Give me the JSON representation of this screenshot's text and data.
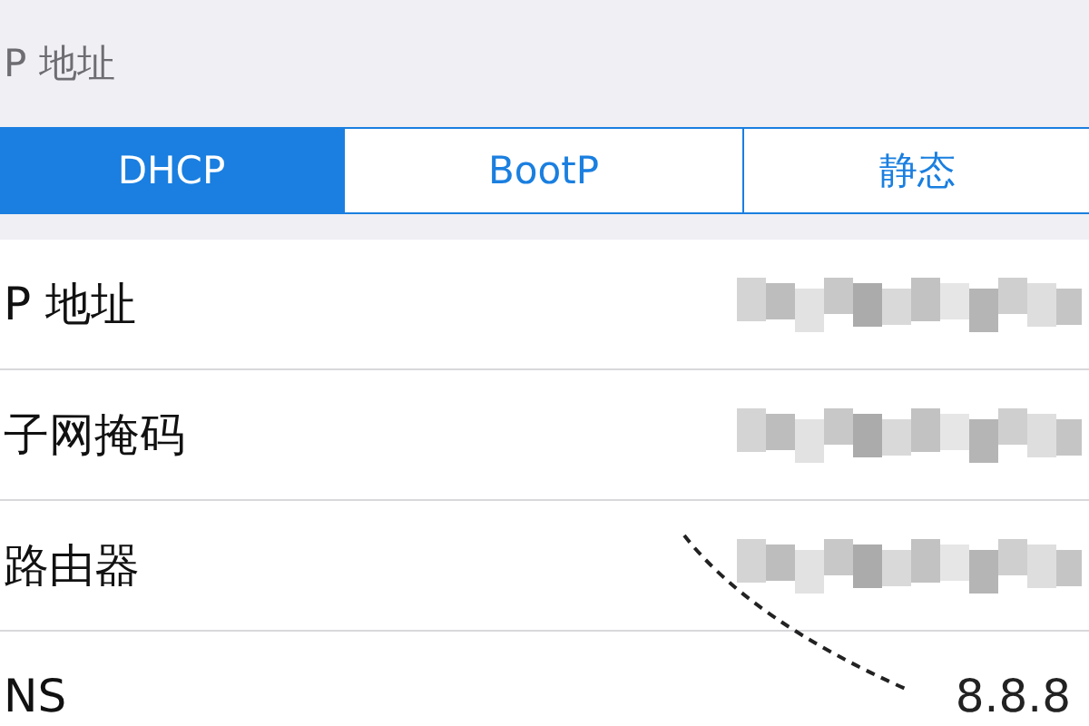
{
  "section_header": "P 地址",
  "segments": [
    {
      "label": "DHCP",
      "selected": true
    },
    {
      "label": "BootP",
      "selected": false
    },
    {
      "label": "静态",
      "selected": false
    }
  ],
  "rows": [
    {
      "label": "P 地址",
      "kind": "blurred"
    },
    {
      "label": "子网掩码",
      "kind": "blurred"
    },
    {
      "label": "路由器",
      "kind": "blurred"
    },
    {
      "label": "NS",
      "kind": "text",
      "value": "8.8.8"
    }
  ]
}
